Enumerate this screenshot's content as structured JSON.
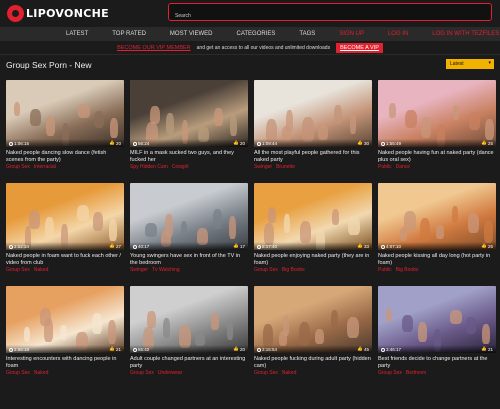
{
  "header": {
    "logo_text": "LIPOVONCHE",
    "search_placeholder": "Search"
  },
  "nav": {
    "items": [
      {
        "label": "Latest",
        "color": "#dddddd"
      },
      {
        "label": "Top Rated",
        "color": "#dddddd"
      },
      {
        "label": "Most Viewed",
        "color": "#dddddd"
      },
      {
        "label": "Categories",
        "color": "#dddddd"
      },
      {
        "label": "Tags",
        "color": "#dddddd"
      },
      {
        "label": "Sign up",
        "color": "#e0212f"
      },
      {
        "label": "Log in",
        "color": "#e0212f"
      },
      {
        "label": "Log in with TezFiles",
        "color": "#e0212f"
      }
    ]
  },
  "vip": {
    "link": "Become our VIP member",
    "text": "and get an access to all our videos and unlimited downloads",
    "button": "Become a VIP"
  },
  "page": {
    "title": "Group Sex Porn - New",
    "sort_selected": "Latest"
  },
  "videos": [
    {
      "title": "Naked people dancing slow dance (fetish scenes from the party)",
      "duration": "1:06:15",
      "likes": "20",
      "tags": [
        "Group Sex",
        "Interracial"
      ],
      "palette": [
        "#d9cbb8",
        "#8a6e58",
        "#3a3028"
      ]
    },
    {
      "title": "MILF in a mask sucked two guys, and they fucked her",
      "duration": "56:24",
      "likes": "20",
      "tags": [
        "Spy Hidden Cam",
        "Cowgirl"
      ],
      "palette": [
        "#4a4038",
        "#b89c7c",
        "#2a2420"
      ]
    },
    {
      "title": "All the most playful people gathered for this naked party",
      "duration": "1:09:44",
      "likes": "30",
      "tags": [
        "Swinger",
        "Brunette"
      ],
      "palette": [
        "#e8e4dc",
        "#c49478",
        "#5a4636"
      ]
    },
    {
      "title": "Naked people having fun at naked party (dance plus oral sex)",
      "duration": "1:55:49",
      "likes": "25",
      "tags": [
        "Public",
        "Dance"
      ],
      "palette": [
        "#e8b4c0",
        "#c88060",
        "#6a4a3a"
      ]
    },
    {
      "title": "Naked people in foam want to fuck each other / video from club",
      "duration": "2:52:34",
      "likes": "27",
      "tags": [
        "Group Sex",
        "Naked"
      ],
      "palette": [
        "#e69a3a",
        "#f4d6a8",
        "#8a5a2a"
      ]
    },
    {
      "title": "Young swingers have sex in front of the TV in the bedroom",
      "duration": "40:17",
      "likes": "17",
      "tags": [
        "Swinger",
        "Tv Watching"
      ],
      "palette": [
        "#c8ccd0",
        "#7a8088",
        "#3a3e44"
      ]
    },
    {
      "title": "Naked people enjoying naked party (they are in foam)",
      "duration": "5:17:40",
      "likes": "33",
      "tags": [
        "Group Sex",
        "Big Boobs"
      ],
      "palette": [
        "#e8a040",
        "#f2d8b0",
        "#7a5020"
      ]
    },
    {
      "title": "Naked people kissing all day long (hot party in foam)",
      "duration": "4:07:10",
      "likes": "26",
      "tags": [
        "Public",
        "Big Boobs"
      ],
      "palette": [
        "#f0c890",
        "#d07a40",
        "#7a4a2a"
      ]
    },
    {
      "title": "Interesting encounters with dancing people in foam",
      "duration": "2:58:18",
      "likes": "21",
      "tags": [
        "Group Sex",
        "Naked"
      ],
      "palette": [
        "#e6a060",
        "#f6e6d0",
        "#5a3a22"
      ]
    },
    {
      "title": "Adult couple changed partners at an interesting party",
      "duration": "55:42",
      "likes": "20",
      "tags": [
        "Group Sex",
        "Underwear"
      ],
      "palette": [
        "#cfcfcf",
        "#8a8a8a",
        "#3a3a3a"
      ]
    },
    {
      "title": "Naked people fucking during adult party (hidden cam)",
      "duration": "2:15:54",
      "likes": "45",
      "tags": [
        "Group Sex",
        "Naked"
      ],
      "palette": [
        "#d6a878",
        "#9a6a48",
        "#4a3a2e"
      ]
    },
    {
      "title": "Best friends decide to change partners at the party",
      "duration": "3:46:17",
      "likes": "21",
      "tags": [
        "Group Sex",
        "Bedroom"
      ],
      "palette": [
        "#a0a0c8",
        "#6a5a8a",
        "#2a2438"
      ]
    }
  ]
}
